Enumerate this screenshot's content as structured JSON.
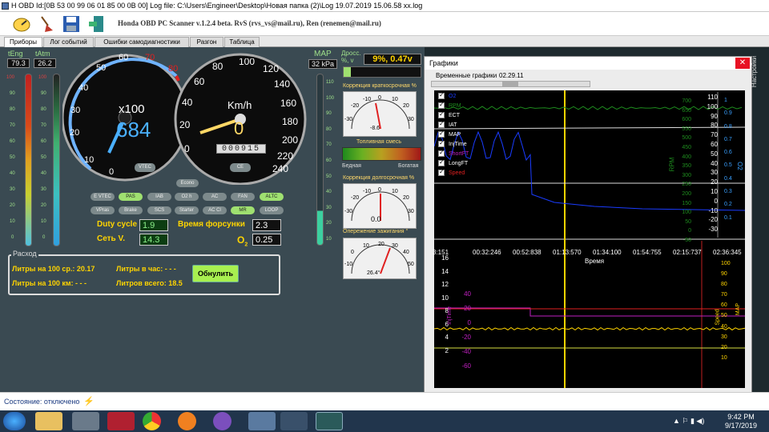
{
  "window": {
    "title": "H OBD Id:[0B 53 00 99 06 01 85 00 0B 00] Log file: C:\\Users\\Engineer\\Desktop\\Новая папка (2)\\Log 19.07.2019 15.06.58 xx.log"
  },
  "toolbar": {
    "app_title": "Honda OBD PC Scanner v.1.2.4 beta. RvS (rvs_vs@mail.ru), Ren (renemen@mail.ru)",
    "icons": [
      "gauge-icon",
      "broom-icon",
      "save-icon",
      "exit-door-icon"
    ]
  },
  "tabs": [
    "Приборы",
    "Лог событий",
    "Ошибки самодиагностики",
    "Разгон",
    "Таблица"
  ],
  "temps": {
    "eng_label": "tEng",
    "atm_label": "tAtm",
    "eng_value": "79.3",
    "atm_value": "26.2"
  },
  "map": {
    "label": "MAP",
    "value": "32 kPa",
    "scale": [
      "110",
      "100",
      "90",
      "80",
      "70",
      "60",
      "50",
      "40",
      "30",
      "20",
      "10"
    ]
  },
  "throttle": {
    "label": "Дросс. %, v",
    "value": "9%, 0.47v",
    "level": 0.09
  },
  "rpm_gauge": {
    "unit": "x100",
    "value": "684",
    "ticks": [
      "0",
      "10",
      "20",
      "30",
      "40",
      "50",
      "60",
      "70",
      "80"
    ],
    "badge": "VTEC"
  },
  "speed_gauge": {
    "unit": "Km/h",
    "value": "0",
    "ticks": [
      "0",
      "20",
      "40",
      "60",
      "80",
      "100",
      "120",
      "140",
      "160",
      "180",
      "200",
      "220",
      "240"
    ],
    "odometer": "000915",
    "badge": "CE"
  },
  "indicators": {
    "top": "Econo",
    "row1": [
      {
        "label": "E VTEC",
        "on": false
      },
      {
        "label": "PAS",
        "on": true
      },
      {
        "label": "IAB",
        "on": false
      },
      {
        "label": "O2 h",
        "on": false
      },
      {
        "label": "AC",
        "on": false
      },
      {
        "label": "FAN",
        "on": false
      },
      {
        "label": "ALTC",
        "on": true
      }
    ],
    "row2": [
      {
        "label": "VPras",
        "on": false
      },
      {
        "label": "Brake",
        "on": false
      },
      {
        "label": "SCS",
        "on": false
      },
      {
        "label": "Starter",
        "on": false
      },
      {
        "label": "AC Cl",
        "on": false
      },
      {
        "label": "MR",
        "on": true
      },
      {
        "label": "LOOP",
        "on": false
      }
    ]
  },
  "readouts": {
    "duty_label": "Duty cycle",
    "duty_value": "1.9",
    "inj_label": "Время форсунки",
    "inj_value": "2.3",
    "volt_label": "Сеть V.",
    "volt_value": "14.3",
    "o2_label": "O",
    "o2_sub": "2",
    "o2_value": "0.25"
  },
  "consumption": {
    "title": "Расход",
    "per100_avg": "Литры на 100 ср.: 20.17",
    "per_hour": "Литры в час: - - -",
    "per100_km": "Литры на 100 км: - - -",
    "total": "Литров всего: 18.5",
    "reset_button": "Обнулить"
  },
  "short_trim": {
    "title": "Коррекция краткосрочная %",
    "ticks": [
      "-30",
      "-20",
      "-10",
      "0",
      "10",
      "20",
      "30"
    ],
    "value": "-8.6"
  },
  "mixture": {
    "title": "Топливная смесь",
    "lean": "Бедная",
    "rich": "Богатая"
  },
  "long_trim": {
    "title": "Коррекция долгосрочная %",
    "ticks": [
      "-30",
      "-20",
      "-10",
      "0",
      "10",
      "20",
      "30"
    ],
    "value": "0.0"
  },
  "ignition": {
    "title": "Опережение зажигания °",
    "ticks": [
      "-10",
      "0",
      "10",
      "20",
      "30",
      "40",
      "50"
    ],
    "value": "26.4°"
  },
  "graphs": {
    "title": "Графики",
    "subtitle": "Временные графики",
    "time": "02.29.11",
    "series": [
      {
        "name": "O2",
        "color": "#1a3cff"
      },
      {
        "name": "RPM",
        "color": "#1e8b1e"
      },
      {
        "name": "ECT",
        "color": "#ffffff"
      },
      {
        "name": "IAT",
        "color": "#ffffff"
      },
      {
        "name": "MAP",
        "color": "#ffffff"
      },
      {
        "name": "InjTime",
        "color": "#ffffff"
      },
      {
        "name": "ShortFT",
        "color": "#c020c0"
      },
      {
        "name": "LongFT",
        "color": "#ffffff"
      },
      {
        "name": "Speed",
        "color": "#e02020"
      }
    ],
    "time_axis": [
      "3:151",
      "00:32:246",
      "00:52:838",
      "01:13:570",
      "01:34:100",
      "01:54:755",
      "02:15:737",
      "02:36:345"
    ],
    "time_label": "Время",
    "rpm_axis": [
      "700",
      "650",
      "600",
      "550",
      "500",
      "450",
      "400",
      "350",
      "300",
      "250",
      "200",
      "150",
      "100",
      "50",
      "0",
      "-50"
    ],
    "ect_axis": [
      "110",
      "100",
      "90",
      "80",
      "70",
      "60",
      "50",
      "40",
      "30",
      "20",
      "10",
      "0",
      "-10",
      "-20",
      "-30"
    ],
    "o2_axis": [
      "1",
      "0.9",
      "0.8",
      "0.7",
      "0.6",
      "0.5",
      "0.4",
      "0.3",
      "0.2",
      "0.1"
    ],
    "lower_left_axis": [
      "16",
      "14",
      "12",
      "10",
      "8",
      "6",
      "4",
      "2"
    ],
    "lower_inner_axis": [
      "40",
      "20",
      "0",
      "-20",
      "-40",
      "-60"
    ],
    "lower_right_axis": [
      "100",
      "90",
      "80",
      "70",
      "60",
      "50",
      "40",
      "30",
      "20",
      "10"
    ],
    "axis_rpm": "RPM",
    "axis_o2": "O2",
    "axis_injtime": "InjTime",
    "axis_speed": "Speed",
    "axis_map": "MAP"
  },
  "side": {
    "label": "Настройки"
  },
  "status": {
    "text": "Состояние: отключено"
  },
  "taskbar": {
    "time": "9:42 PM",
    "date": "9/17/2019",
    "apps": [
      "start-orb-icon",
      "file-explorer-icon",
      "calculator-icon",
      "winrar-icon",
      "chrome-icon",
      "avast-icon",
      "viber-icon",
      "network-icon",
      "chrome-icon",
      "obd-scanner-icon"
    ]
  }
}
